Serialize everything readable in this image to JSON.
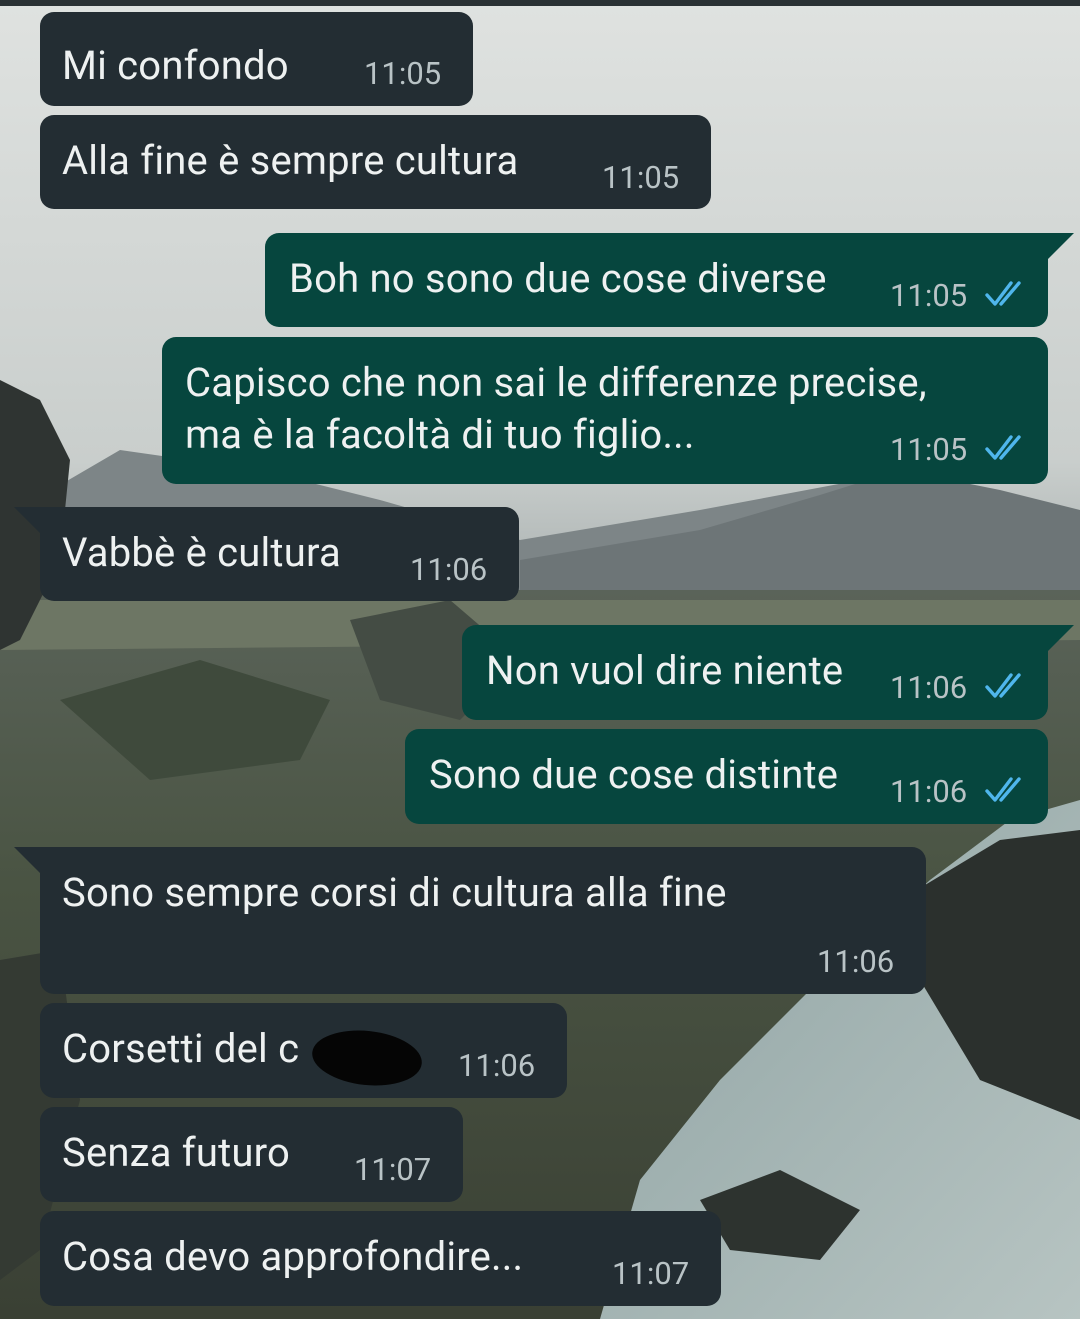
{
  "chat": {
    "messages": [
      {
        "dir": "in",
        "text": "Mi confondo",
        "time": "11:05"
      },
      {
        "dir": "in",
        "text": "Alla fine è sempre cultura",
        "time": "11:05"
      },
      {
        "dir": "out",
        "text": "Boh no sono due cose diverse",
        "time": "11:05",
        "status": "read"
      },
      {
        "dir": "out",
        "text": "Capisco che non sai le differenze precise,",
        "text2": "ma è la facoltà di tuo figlio...",
        "time": "11:05",
        "status": "read"
      },
      {
        "dir": "in",
        "text": "Vabbè è cultura",
        "time": "11:06"
      },
      {
        "dir": "out",
        "text": "Non vuol dire niente",
        "time": "11:06",
        "status": "read"
      },
      {
        "dir": "out",
        "text": "Sono due cose distinte",
        "time": "11:06",
        "status": "read"
      },
      {
        "dir": "in",
        "text": "Sono sempre corsi di cultura alla fine",
        "time": "11:06"
      },
      {
        "dir": "in",
        "text": "Corsetti del c",
        "time": "11:06",
        "redacted": true
      },
      {
        "dir": "in",
        "text": "Senza futuro",
        "time": "11:07"
      },
      {
        "dir": "in",
        "text": "Cosa devo approfondire...",
        "time": "11:07"
      }
    ]
  },
  "colors": {
    "incoming_bubble": "#232d33",
    "outgoing_bubble": "#06463e",
    "read_ticks": "#4fb6ec",
    "text": "#eef1f1",
    "timestamp": "#b9c3c6"
  },
  "icons": {
    "read_status": "double-check-icon"
  }
}
